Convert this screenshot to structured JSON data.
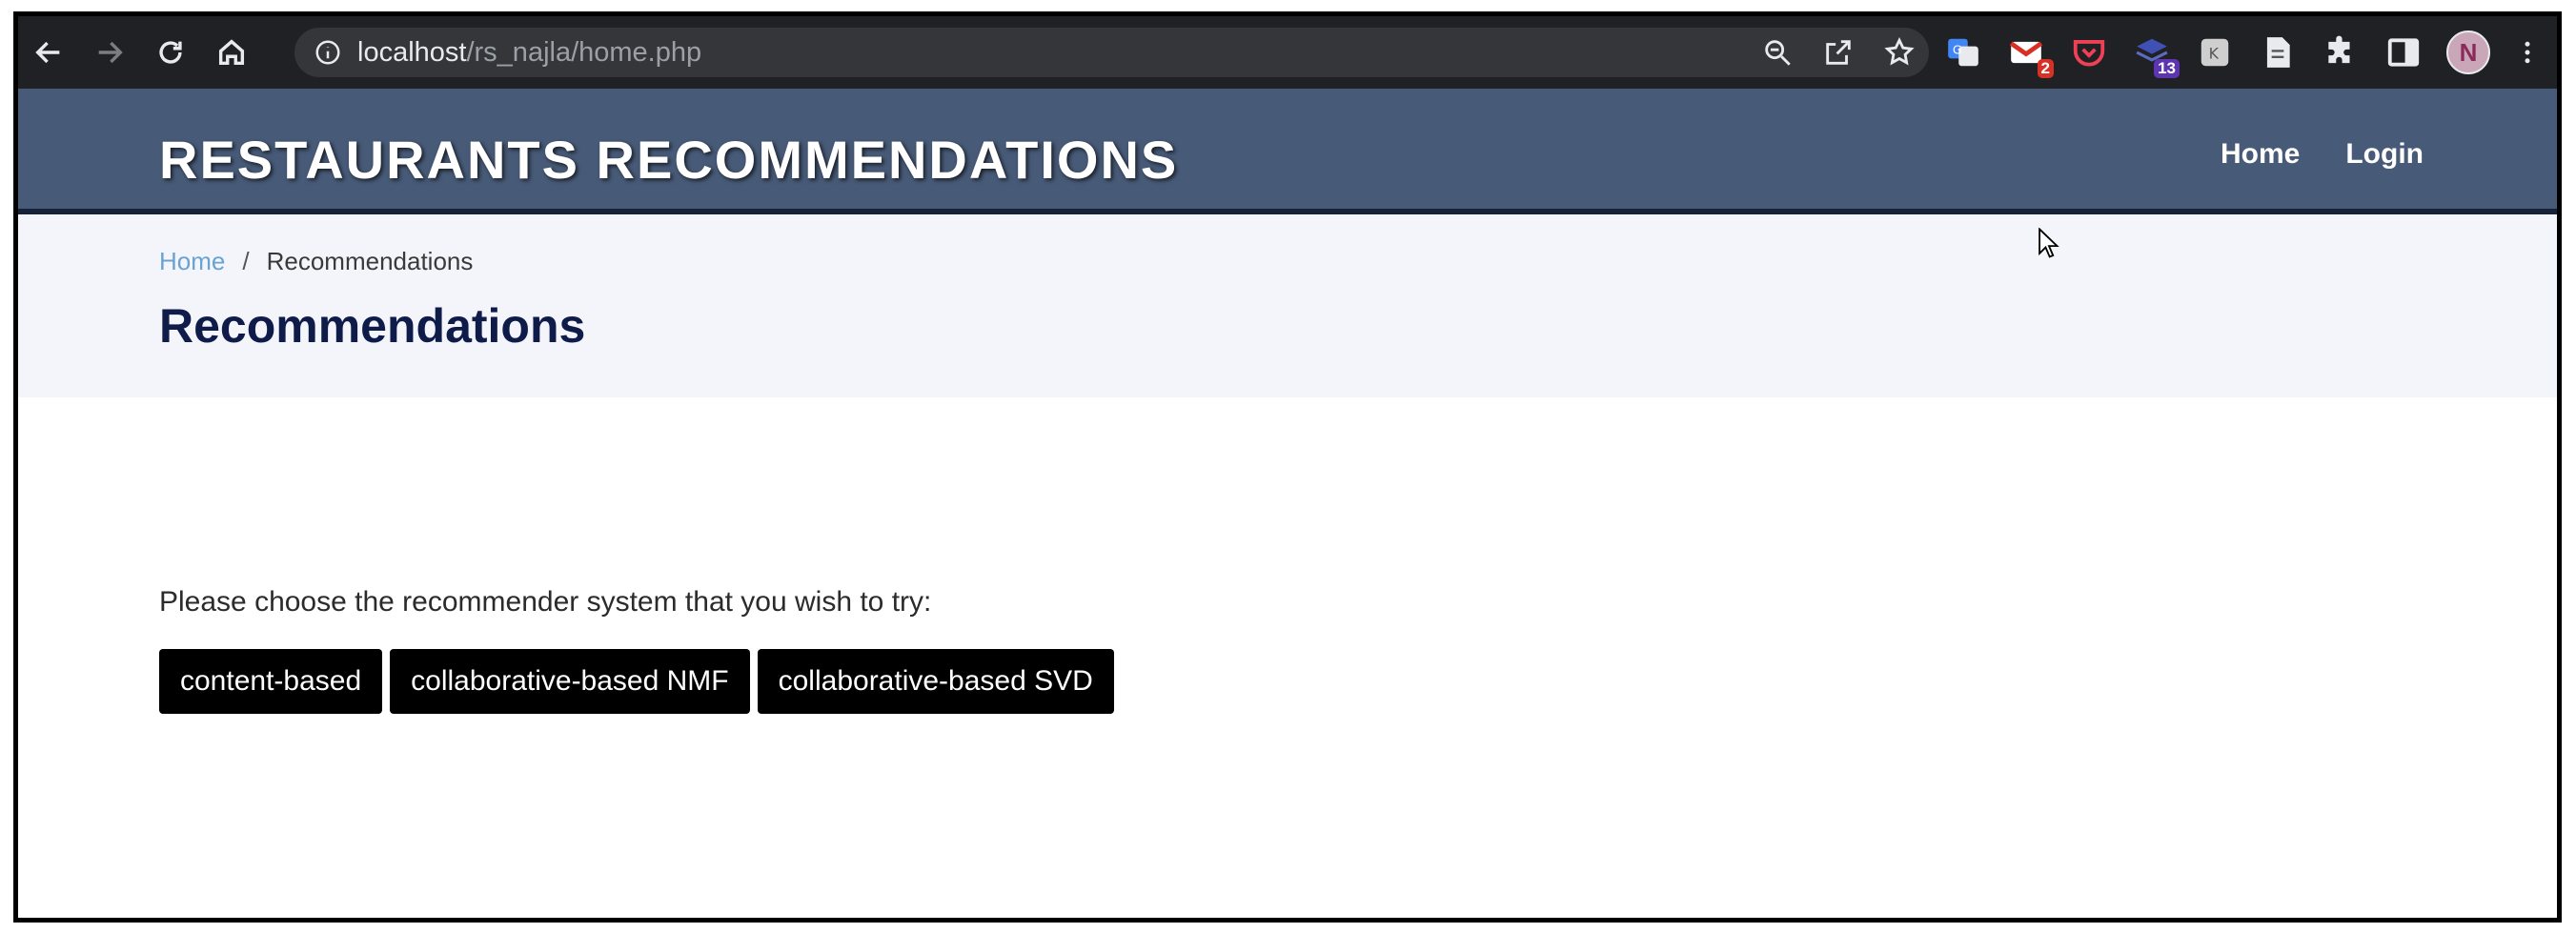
{
  "browser": {
    "url_host": "localhost",
    "url_path": "/rs_najla/home.php",
    "extensions": [
      {
        "name": "translate",
        "badge": ""
      },
      {
        "name": "mail",
        "badge": "2",
        "badge_color": "#d93025"
      },
      {
        "name": "pocket",
        "badge": ""
      },
      {
        "name": "stack",
        "badge": "13",
        "badge_color": "#5e35b1"
      },
      {
        "name": "kami",
        "badge": ""
      },
      {
        "name": "document",
        "badge": ""
      }
    ],
    "avatar_initial": "N"
  },
  "site": {
    "brand": "RESTAURANTS RECOMMENDATIONS",
    "nav": {
      "home": "Home",
      "login": "Login"
    }
  },
  "breadcrumb": {
    "home": "Home",
    "separator": "/",
    "current": "Recommendations"
  },
  "page": {
    "title": "Recommendations",
    "prompt": "Please choose the recommender system that you wish to try:",
    "buttons": {
      "content_based": "content-based",
      "nmf": "collaborative-based NMF",
      "svd": "collaborative-based SVD"
    }
  },
  "colors": {
    "header_bg": "#475a77",
    "toolbar_bg": "#202124",
    "breadcrumb_bg": "#f4f5fa",
    "title_color": "#0f1c4a",
    "link_color": "#6aa3d1",
    "button_bg": "#000000"
  }
}
